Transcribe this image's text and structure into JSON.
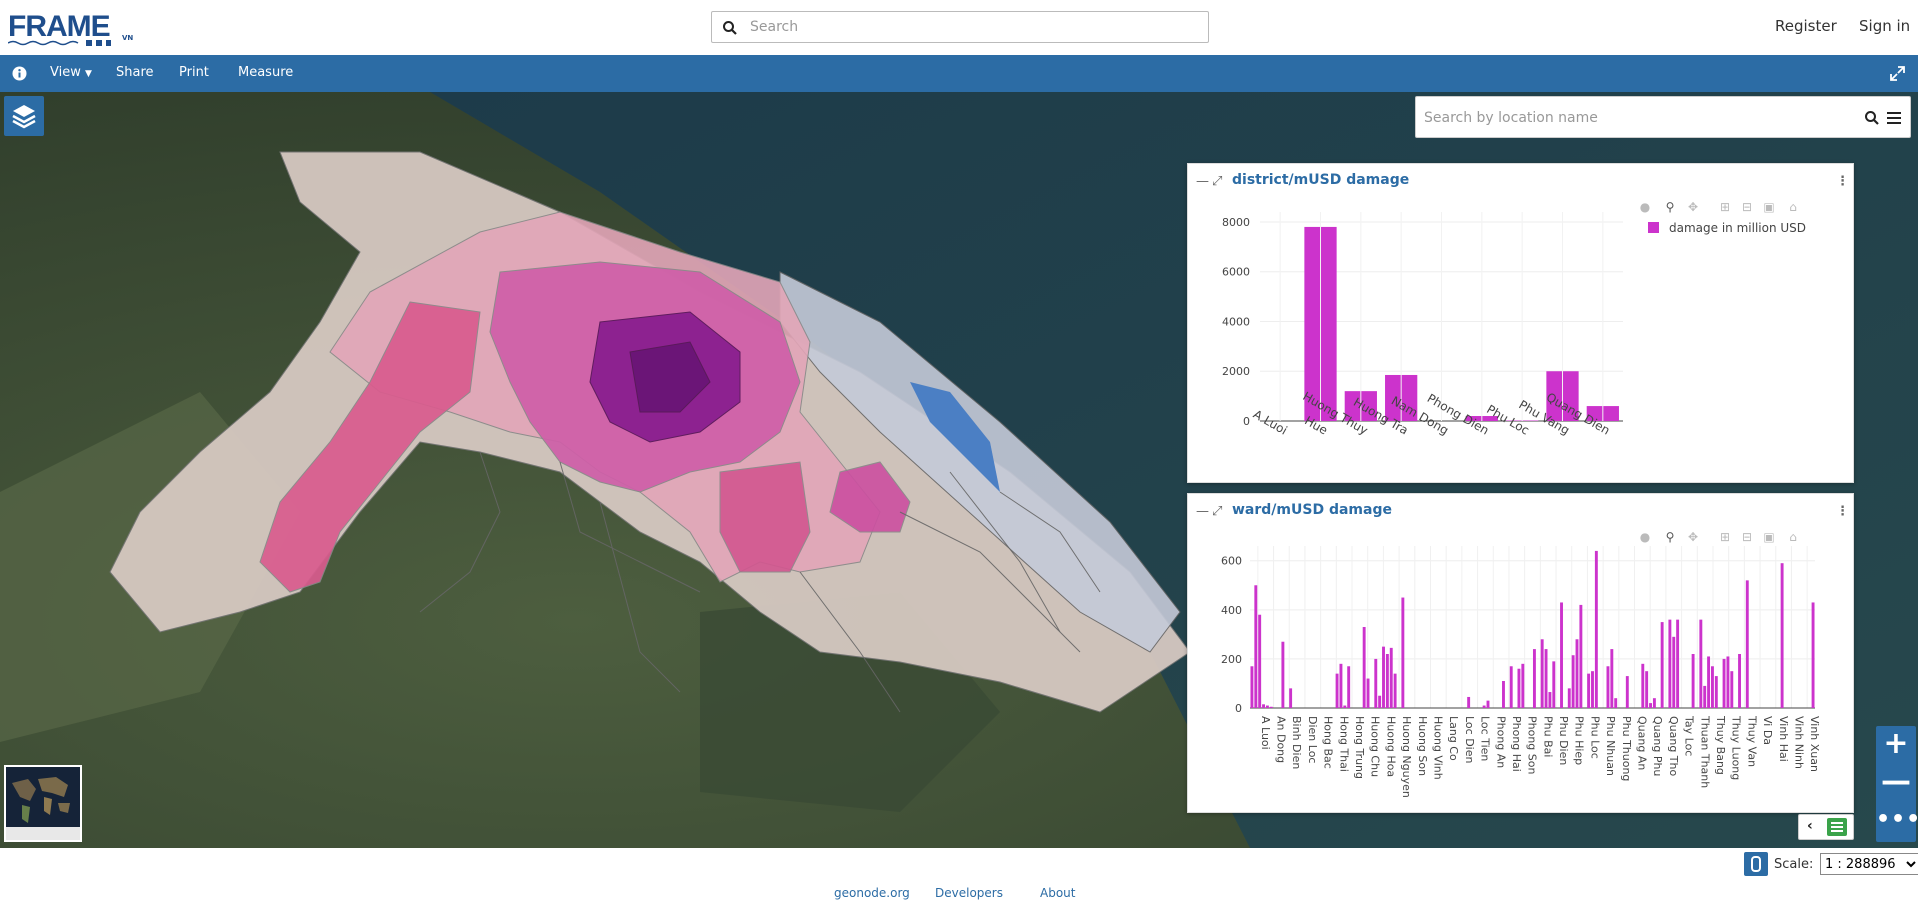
{
  "header": {
    "logo_text": "FRAME",
    "logo_suffix": "VN",
    "search_placeholder": "Search",
    "register": "Register",
    "sign_in": "Sign in"
  },
  "nav": {
    "items": [
      "View",
      "Share",
      "Print",
      "Measure"
    ]
  },
  "map": {
    "location_search_placeholder": "Search by location name"
  },
  "widgets": [
    {
      "title": "district/mUSD damage",
      "chart_data": {
        "type": "bar",
        "categories": [
          "A Luoi",
          "Hue",
          "Huong Thuy",
          "Huong Tra",
          "Nam Dong",
          "Phong Dien",
          "Phu Loc",
          "Phu Vang",
          "Quang Dien"
        ],
        "series": [
          {
            "name": "damage in million USD",
            "values": [
              0,
              7800,
              1200,
              1850,
              0,
              200,
              20,
              2000,
              600
            ]
          }
        ],
        "yticks": [
          0,
          2000,
          4000,
          6000,
          8000
        ],
        "ylim": [
          0,
          8400
        ],
        "color": "#cc33cc",
        "legend": "top-right",
        "grid": true
      }
    },
    {
      "title": "ward/mUSD damage",
      "chart_data": {
        "type": "bar",
        "tick_labels": [
          "A Luoi",
          "An Dong",
          "Binh Dien",
          "Dien Loc",
          "Hong Bac",
          "Hong Thai",
          "Hong Trung",
          "Huong Chu",
          "Huong Hoa",
          "Huong Nguyen",
          "Huong Son",
          "Huong Vinh",
          "Lang Co",
          "Loc Dien",
          "Loc Tien",
          "Phong An",
          "Phong Hai",
          "Phong Son",
          "Phu Bai",
          "Phu Dien",
          "Phu Hiep",
          "Phu Loc",
          "Phu Nhuan",
          "Phu Thuong",
          "Quang An",
          "Quang Phu",
          "Quang Tho",
          "Tay Loc",
          "Thuan Thanh",
          "Thuy Bang",
          "Thuy Luong",
          "Thuy Van",
          "Vi Da",
          "Vinh Hai",
          "Vinh Ninh",
          "Vinh Xuan"
        ],
        "values": [
          170,
          500,
          380,
          15,
          10,
          5,
          0,
          0,
          270,
          0,
          80,
          0,
          0,
          0,
          0,
          0,
          0,
          0,
          0,
          0,
          0,
          0,
          140,
          180,
          10,
          170,
          0,
          0,
          0,
          330,
          120,
          0,
          200,
          50,
          250,
          220,
          245,
          140,
          0,
          450,
          0,
          0,
          0,
          0,
          0,
          0,
          0,
          0,
          0,
          0,
          0,
          0,
          0,
          0,
          0,
          0,
          45,
          0,
          0,
          0,
          10,
          30,
          0,
          0,
          0,
          110,
          0,
          170,
          0,
          160,
          180,
          0,
          0,
          240,
          0,
          280,
          240,
          65,
          190,
          0,
          430,
          0,
          80,
          215,
          280,
          420,
          0,
          140,
          150,
          640,
          0,
          0,
          170,
          240,
          40,
          0,
          0,
          130,
          0,
          0,
          0,
          180,
          150,
          20,
          40,
          0,
          350,
          0,
          360,
          290,
          360,
          0,
          0,
          0,
          220,
          0,
          360,
          90,
          210,
          170,
          130,
          0,
          200,
          210,
          150,
          0,
          220,
          0,
          520,
          0,
          0,
          0,
          0,
          0,
          0,
          0,
          0,
          590,
          0,
          0,
          0,
          0,
          0,
          0,
          0,
          430
        ],
        "yticks": [
          0,
          200,
          400,
          600
        ],
        "ylim": [
          0,
          660
        ],
        "color": "#cc33cc",
        "grid": true
      }
    }
  ],
  "scale": {
    "label": "Scale:",
    "value": "1 : 288896"
  },
  "footer": {
    "links": [
      "geonode.org",
      "Developers",
      "About"
    ]
  },
  "colors": {
    "brand": "#2c6ca5",
    "bar": "#cc33cc"
  }
}
